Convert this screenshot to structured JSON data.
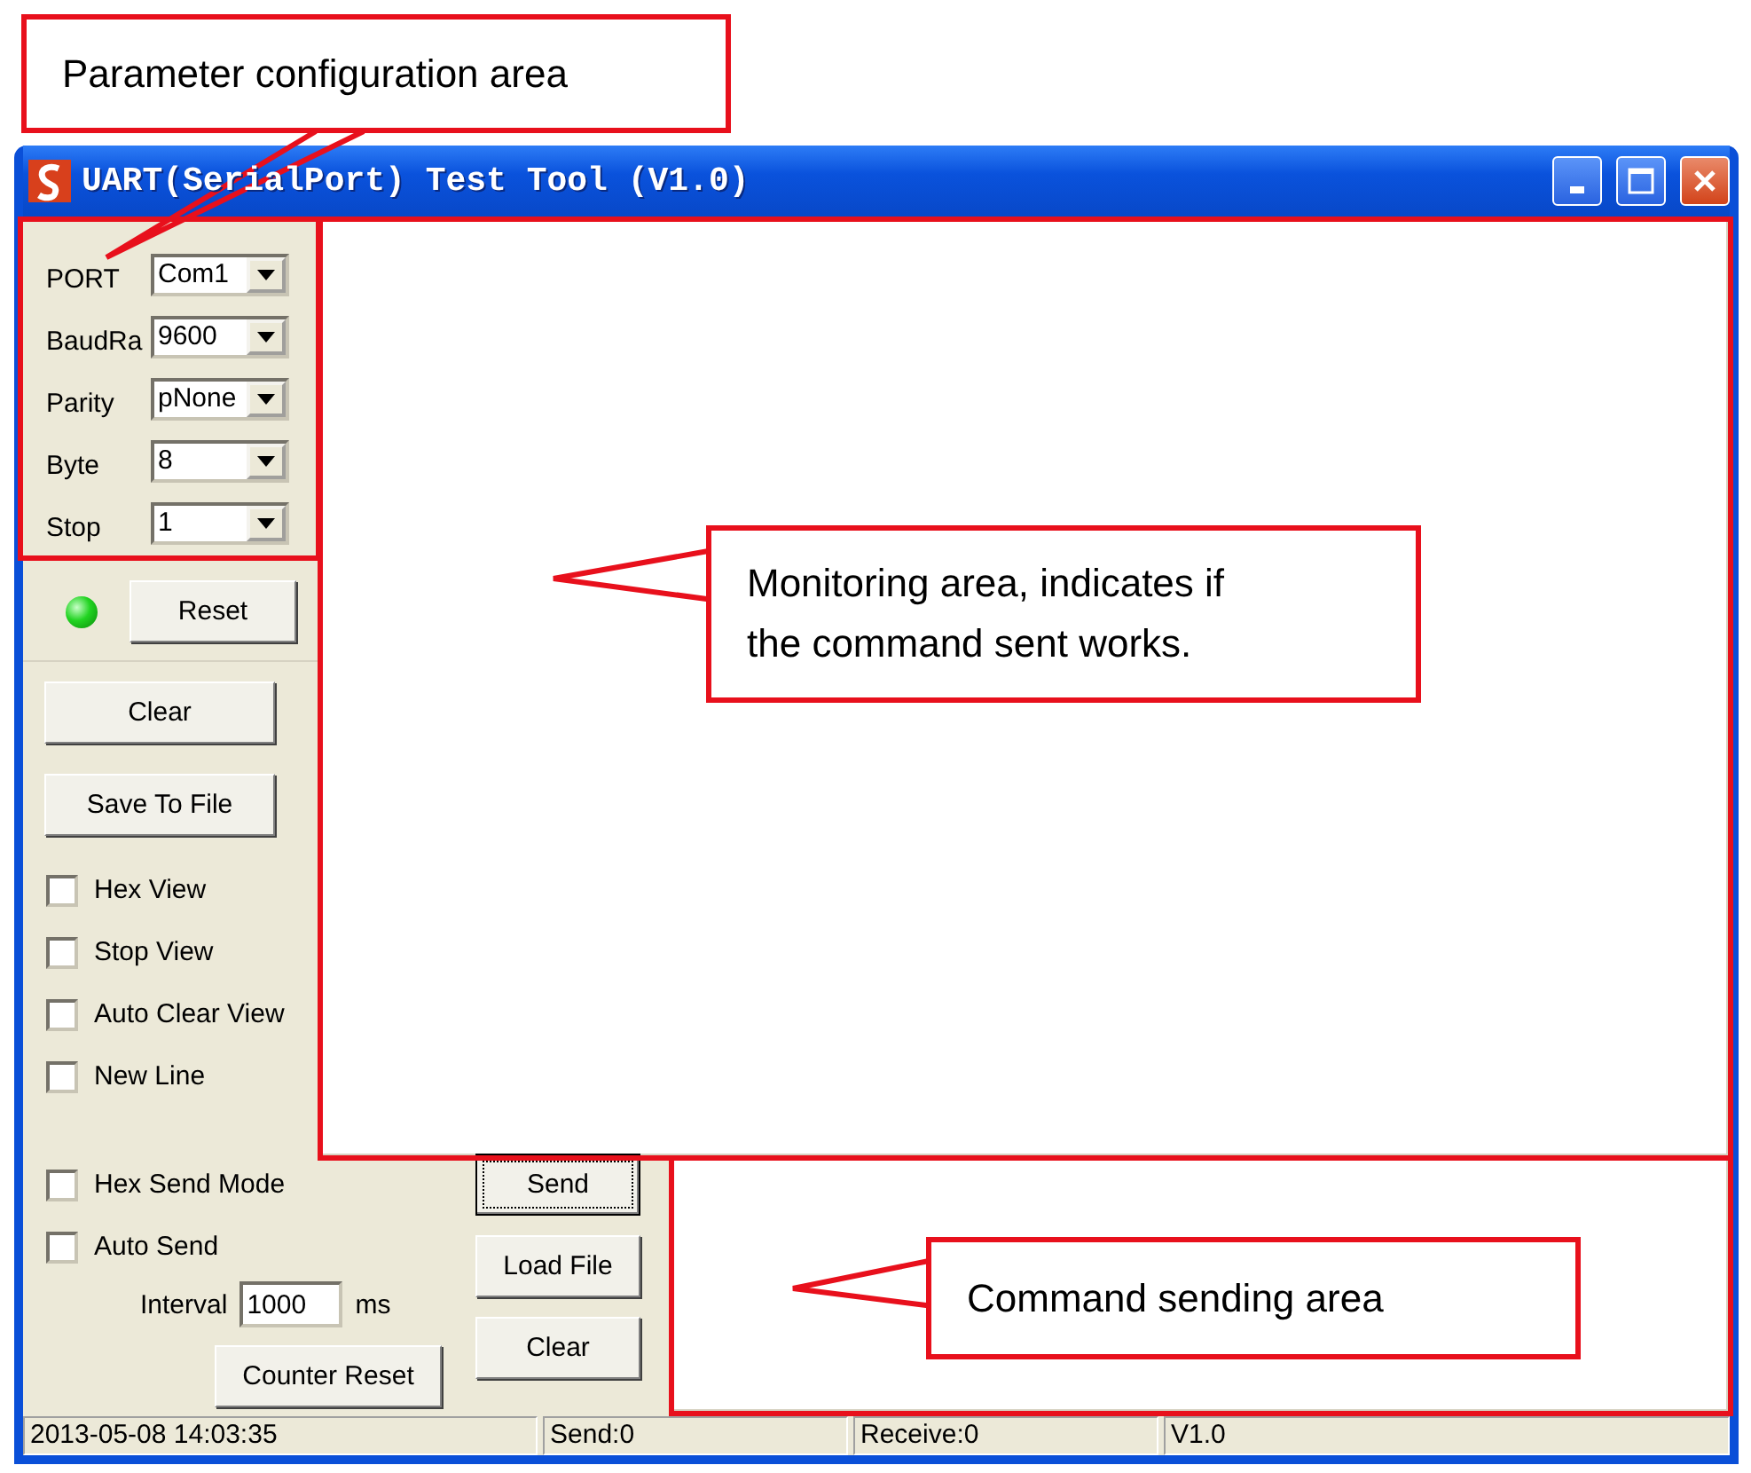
{
  "callouts": [
    {
      "text": "Parameter configuration area"
    },
    {
      "text": "Monitoring area, indicates if the command sent works."
    },
    {
      "text": "Command sending area"
    }
  ],
  "window": {
    "title": "UART(SerialPort) Test Tool (V1.0)"
  },
  "settings": [
    {
      "label": "PORT",
      "value": "Com1"
    },
    {
      "label": "BaudRa",
      "value": "9600"
    },
    {
      "label": "Parity",
      "value": "pNone"
    },
    {
      "label": "Byte",
      "value": "8"
    },
    {
      "label": "Stop",
      "value": "1"
    }
  ],
  "status_led": {
    "on": true
  },
  "reset_button": "Reset",
  "view_buttons": [
    "Clear",
    "Save To File"
  ],
  "view_options": [
    {
      "label": "Hex View",
      "checked": false
    },
    {
      "label": "Stop View",
      "checked": false
    },
    {
      "label": "Auto Clear View",
      "checked": false
    },
    {
      "label": "New Line",
      "checked": false
    }
  ],
  "send_options": [
    {
      "label": "Hex Send Mode",
      "checked": false
    },
    {
      "label": "Auto Send",
      "checked": false
    }
  ],
  "interval": {
    "label": "Interval",
    "value": "1000",
    "unit": "ms"
  },
  "counter_reset": "Counter Reset",
  "send_buttons": [
    {
      "label": "Send",
      "focused": true
    },
    {
      "label": "Load File",
      "focused": false
    },
    {
      "label": "Clear",
      "focused": false
    }
  ],
  "status_bar": [
    "2013-05-08 14:03:35",
    "Send:0",
    "Receive:0",
    "V1.0"
  ]
}
